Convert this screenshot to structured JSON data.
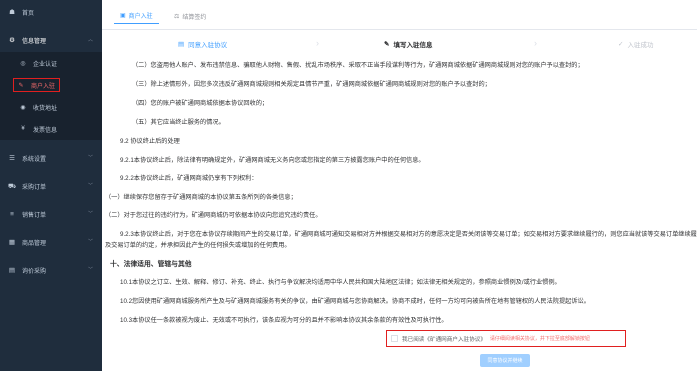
{
  "sidebar": {
    "items": [
      {
        "icon": "home-icon",
        "glyph": "☗",
        "label": "首页"
      },
      {
        "icon": "gear-icon",
        "glyph": "⚙",
        "label": "信息管理",
        "chevron": "︿"
      }
    ],
    "sub_items": [
      {
        "icon": "shield-icon",
        "glyph": "◎",
        "label": "企业认证"
      },
      {
        "icon": "edit-icon",
        "glyph": "✎",
        "label": "商户入驻"
      },
      {
        "icon": "location-icon",
        "glyph": "◉",
        "label": "收货地址"
      },
      {
        "icon": "invoice-icon",
        "glyph": "¥",
        "label": "发票信息"
      }
    ],
    "lower_items": [
      {
        "icon": "settings-icon",
        "glyph": "☰",
        "label": "系统设置",
        "chevron": "﹀"
      },
      {
        "icon": "cart-icon",
        "glyph": "⛟",
        "label": "采购订单",
        "chevron": "﹀"
      },
      {
        "icon": "list-icon",
        "glyph": "≡",
        "label": "销售订单",
        "chevron": "﹀"
      },
      {
        "icon": "goods-icon",
        "glyph": "▦",
        "label": "商品管理",
        "chevron": "﹀"
      },
      {
        "icon": "price-icon",
        "glyph": "▤",
        "label": "询价采购",
        "chevron": "﹀"
      }
    ]
  },
  "tabs": [
    {
      "glyph": "▣",
      "label": "商户入驻"
    },
    {
      "glyph": "⚖",
      "label": "结算签约"
    }
  ],
  "steps": [
    {
      "glyph": "▤",
      "label": "同意入驻协议"
    },
    {
      "glyph": "✎",
      "label": "填写入驻信息"
    },
    {
      "glyph": "✓",
      "label": "入驻成功"
    }
  ],
  "agreement": {
    "l1": "（二）您盗用他人账户、发布违禁信息、骗取他人财物、售假、扰乱市场秩序、采取不正当手段谋利等行为，矿通网商城依据矿通网商城规则对您的账户予以查封的；",
    "l2": "（三）除上述情形外，因您多次违反矿通网商城规则相关规定且情节严重，矿通网商城依据矿通网商城规则对您的账户予以查封的；",
    "l3": "（四）您的账户被矿通网商城依据本协议回收的；",
    "l4": "（五）其它应当终止服务的情况。",
    "l5": "9.2 协议终止后的处理",
    "l6": "9.2.1本协议终止后，除法律有明确规定外，矿通网商城无义务向您或您指定的第三方披露您账户中的任何信息。",
    "l7": "9.2.2本协议终止后，矿通网商城仍享有下列权利：",
    "l8": "（一）继续保存您留存于矿通网商城的本协议第五条所列的各类信息；",
    "l9": "（二）对于您过往的违约行为，矿通网商城仍可依据本协议向您追究违约责任。",
    "l10": "9.2.3本协议终止后，对于您在本协议存续期间产生的交易订单，矿通网商城可通知交易相对方并根据交易相对方的意愿决定是否关闭该等交易订单；如交易相对方要求继续履行的，则您应当就该等交易订单继续履行本协议",
    "l11": "及交易订单的约定，并承担因此产生的任何损失或增加的任何费用。",
    "l12": "十、法律适用、管辖与其他",
    "l13": "10.1本协议之订立、生效、解释、修订、补充、终止、执行与争议解决均适用中华人民共和国大陆地区法律；如法律无相关规定的，参照商业惯例及/或行业惯例。",
    "l14": "10.2您因使用矿通网商城服务所产生及与矿通网商城服务有关的争议，由矿通网商城与您协商解决。协商不成时，任何一方均可向被告所在地有管辖权的人民法院提起诉讼。",
    "l15": "10.3本协议任一条款被视为废止、无效或不可执行，该条应视为可分的且并不影响本协议其余条款的有效性及可执行性。"
  },
  "consent": {
    "label": "我已阅读《矿通网商户入驻协议》",
    "warning": "请仔细阅读相关协议，并下拉至底部解锁按钮"
  },
  "submit_label": "同意协议并继续"
}
